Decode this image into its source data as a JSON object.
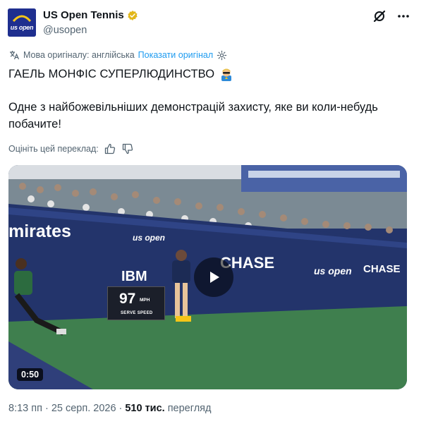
{
  "account": {
    "name": "US Open Tennis",
    "handle": "@usopen",
    "avatar_text": "us open"
  },
  "translation": {
    "original_language": "Мова оригіналу: англійська",
    "show_original": "Показати оригінал"
  },
  "tweet": {
    "title": "ГАЕЛЬ МОНФІС СУПЕРЛЮДИНСТВО",
    "body": "Одне з найбожевільніших демонстрацій захисту, яке ви коли-небудь побачите!"
  },
  "rating": {
    "label": "Оцініть цей переклад:"
  },
  "media": {
    "duration": "0:50",
    "ad_emirates": "mirates",
    "ad_usopen": "us open",
    "ad_chase": "CHASE",
    "ad_ibm": "IBM",
    "ad_usopen2": "us open",
    "ad_chase2": "CHASE",
    "speed_value": "97",
    "speed_unit": "MPH",
    "speed_label": "SERVE SPEED"
  },
  "meta": {
    "time": "8:13 пп",
    "date": "25 серп. 2026",
    "views_count": "510 тис.",
    "views_label": "перегляд"
  },
  "colors": {
    "link": "#1d9bf0",
    "secondary_text": "#536471",
    "verified_gold": "#e2b719",
    "court_green": "#3f7f4e",
    "wall_blue": "#23346b"
  }
}
